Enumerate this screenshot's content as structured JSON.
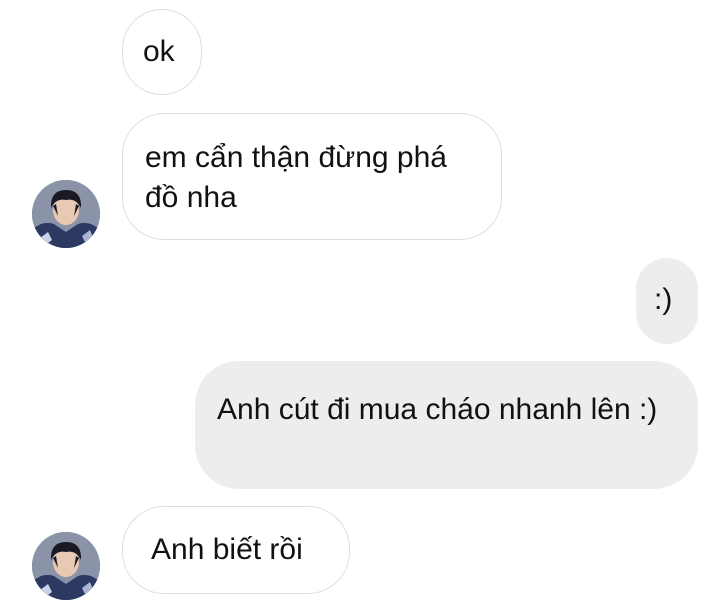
{
  "conversation": {
    "messages": [
      {
        "sender": "other",
        "text": "ok"
      },
      {
        "sender": "other",
        "text": "em cẩn thận đừng phá đồ nha"
      },
      {
        "sender": "me",
        "text": ":)"
      },
      {
        "sender": "me",
        "text": "Anh cút đi mua cháo nhanh lên :)"
      },
      {
        "sender": "other",
        "text": "Anh biết rồi"
      }
    ]
  },
  "colors": {
    "incoming_bubble": "#ffffff",
    "incoming_border": "#dedede",
    "outgoing_bubble": "#ededed",
    "text": "#111111"
  },
  "icons": {
    "contact_avatar": "profile-photo"
  }
}
